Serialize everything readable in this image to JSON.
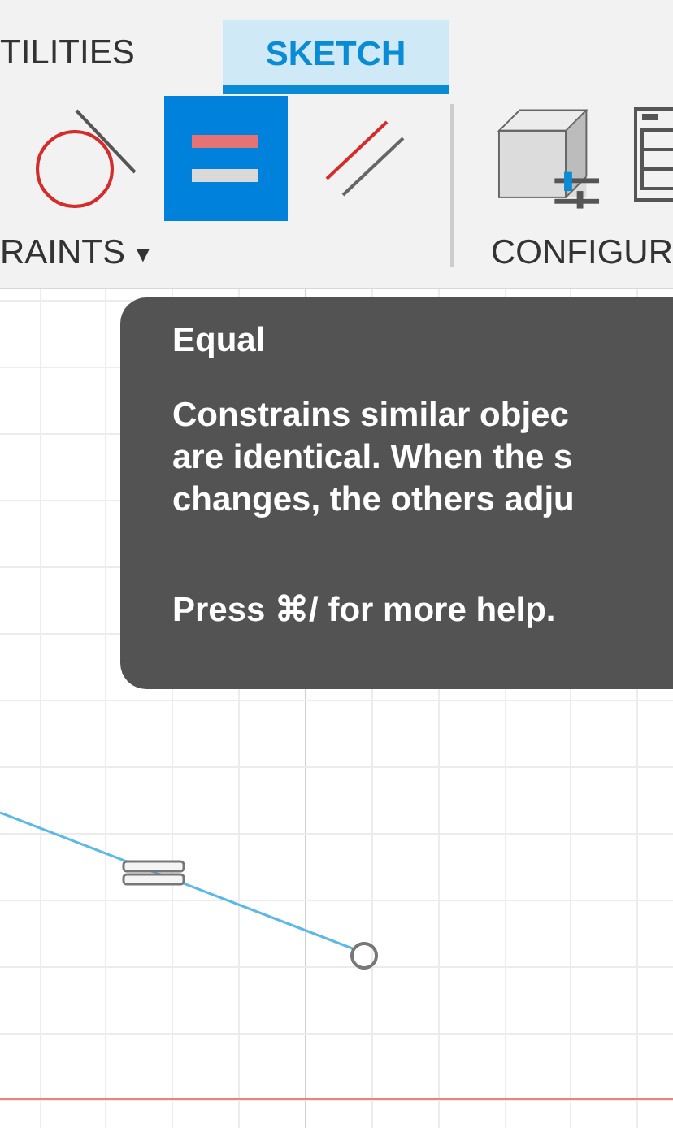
{
  "tabs": [
    {
      "label": "TILITIES",
      "selected": false
    },
    {
      "label": "SKETCH",
      "selected": true
    }
  ],
  "tools": [
    {
      "kind": "tangent",
      "selected": false
    },
    {
      "kind": "equal",
      "selected": true
    },
    {
      "kind": "parallel",
      "selected": false
    }
  ],
  "panels": [
    {
      "label": "RAINTS",
      "caret": "▼"
    },
    {
      "label": "CONFIGUR"
    }
  ],
  "tooltip": {
    "title": "Equal",
    "lines": [
      "Constrains similar objec",
      "are identical. When the s",
      "changes, the others adju"
    ],
    "footer": "Press ⌘/ for more help."
  }
}
